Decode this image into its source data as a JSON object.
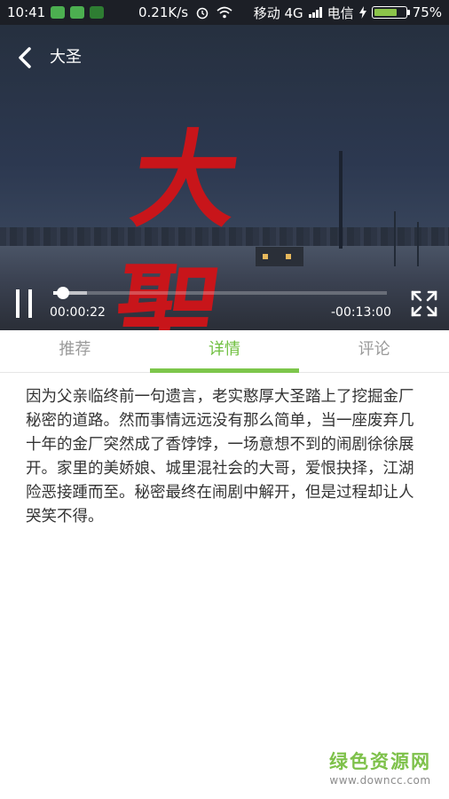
{
  "status_bar": {
    "time": "10:41",
    "speed": "0.21K/s",
    "carrier_1": "移动 4G",
    "carrier_2": "电信",
    "battery_percent": "75%",
    "battery_level": 0.75
  },
  "player": {
    "title": "大圣",
    "poster_title": "大聖",
    "current_time": "00:00:22",
    "remaining_time": "-00:13:00",
    "progress_fraction": 0.028,
    "buffer_fraction": 0.1,
    "title_color": "#c8151a"
  },
  "tabs": [
    {
      "label": "推荐",
      "active": false
    },
    {
      "label": "详情",
      "active": true
    },
    {
      "label": "评论",
      "active": false
    }
  ],
  "details": {
    "description": "因为父亲临终前一句遗言，老实憨厚大圣踏上了挖掘金厂秘密的道路。然而事情远远没有那么简单，当一座废弃几十年的金厂突然成了香饽饽，一场意想不到的闹剧徐徐展开。家里的美娇娘、城里混社会的大哥，爱恨抉择，江湖险恶接踵而至。秘密最终在闹剧中解开，但是过程却让人哭笑不得。"
  },
  "watermark": {
    "main": "绿色资源网",
    "sub": "www.downcc.com"
  },
  "colors": {
    "accent": "#7dc64b",
    "status_bar_bg": "#1c1f26"
  }
}
